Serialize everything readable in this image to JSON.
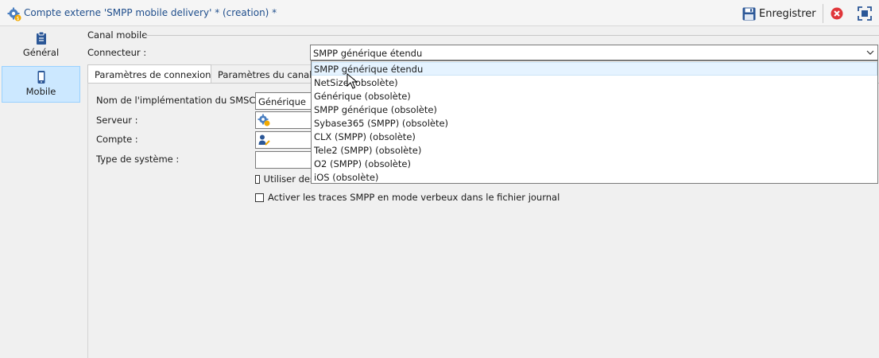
{
  "window": {
    "title": "Compte externe 'SMPP mobile delivery' * (creation) *",
    "save_label": "Enregistrer"
  },
  "sidebar": {
    "items": [
      {
        "label": "Général",
        "icon": "clipboard-icon",
        "selected": false
      },
      {
        "label": "Mobile",
        "icon": "mobile-phone-icon",
        "selected": true
      }
    ]
  },
  "main": {
    "section_title": "Canal mobile",
    "connector_label": "Connecteur :",
    "connector_value": "SMPP générique étendu",
    "tabs": [
      {
        "label": "Paramètres de connexion",
        "active": true
      },
      {
        "label": "Paramètres du canal SMS",
        "active": false
      }
    ],
    "fields": {
      "smsc_impl_label": "Nom de l'implémentation du SMSC :",
      "smsc_impl_value": "Générique",
      "server_label": "Serveur :",
      "account_label": "Compte :",
      "system_type_label": "Type de système :",
      "use_checkbox_label": "Utiliser des",
      "verbose_checkbox_label": "Activer les traces SMPP en mode verbeux dans le fichier journal"
    }
  },
  "dropdown": {
    "options": [
      "SMPP générique étendu",
      "NetSize (obsolète)",
      "Générique (obsolète)",
      "SMPP générique (obsolète)",
      "Sybase365 (SMPP) (obsolète)",
      "CLX (SMPP) (obsolète)",
      "Tele2 (SMPP) (obsolète)",
      "O2 (SMPP) (obsolète)",
      "iOS (obsolète)"
    ],
    "highlighted": "SMPP générique étendu"
  },
  "colors": {
    "accent": "#1f4e8c",
    "selection": "#cce8ff",
    "close_red": "#e0363a"
  }
}
